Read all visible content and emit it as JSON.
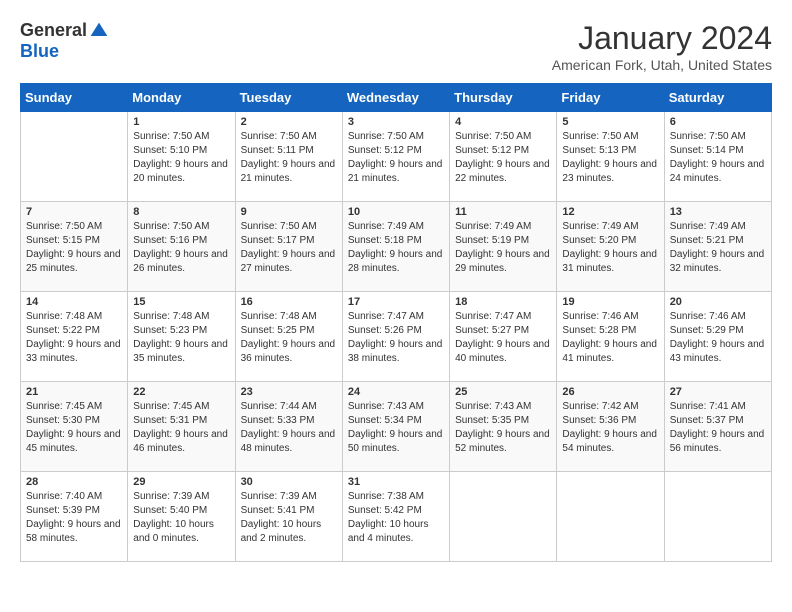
{
  "header": {
    "logo_general": "General",
    "logo_blue": "Blue",
    "title": "January 2024",
    "location": "American Fork, Utah, United States"
  },
  "days_of_week": [
    "Sunday",
    "Monday",
    "Tuesday",
    "Wednesday",
    "Thursday",
    "Friday",
    "Saturday"
  ],
  "weeks": [
    [
      {
        "day": "",
        "sunrise": "",
        "sunset": "",
        "daylight": ""
      },
      {
        "day": "1",
        "sunrise": "Sunrise: 7:50 AM",
        "sunset": "Sunset: 5:10 PM",
        "daylight": "Daylight: 9 hours and 20 minutes."
      },
      {
        "day": "2",
        "sunrise": "Sunrise: 7:50 AM",
        "sunset": "Sunset: 5:11 PM",
        "daylight": "Daylight: 9 hours and 21 minutes."
      },
      {
        "day": "3",
        "sunrise": "Sunrise: 7:50 AM",
        "sunset": "Sunset: 5:12 PM",
        "daylight": "Daylight: 9 hours and 21 minutes."
      },
      {
        "day": "4",
        "sunrise": "Sunrise: 7:50 AM",
        "sunset": "Sunset: 5:12 PM",
        "daylight": "Daylight: 9 hours and 22 minutes."
      },
      {
        "day": "5",
        "sunrise": "Sunrise: 7:50 AM",
        "sunset": "Sunset: 5:13 PM",
        "daylight": "Daylight: 9 hours and 23 minutes."
      },
      {
        "day": "6",
        "sunrise": "Sunrise: 7:50 AM",
        "sunset": "Sunset: 5:14 PM",
        "daylight": "Daylight: 9 hours and 24 minutes."
      }
    ],
    [
      {
        "day": "7",
        "sunrise": "Sunrise: 7:50 AM",
        "sunset": "Sunset: 5:15 PM",
        "daylight": "Daylight: 9 hours and 25 minutes."
      },
      {
        "day": "8",
        "sunrise": "Sunrise: 7:50 AM",
        "sunset": "Sunset: 5:16 PM",
        "daylight": "Daylight: 9 hours and 26 minutes."
      },
      {
        "day": "9",
        "sunrise": "Sunrise: 7:50 AM",
        "sunset": "Sunset: 5:17 PM",
        "daylight": "Daylight: 9 hours and 27 minutes."
      },
      {
        "day": "10",
        "sunrise": "Sunrise: 7:49 AM",
        "sunset": "Sunset: 5:18 PM",
        "daylight": "Daylight: 9 hours and 28 minutes."
      },
      {
        "day": "11",
        "sunrise": "Sunrise: 7:49 AM",
        "sunset": "Sunset: 5:19 PM",
        "daylight": "Daylight: 9 hours and 29 minutes."
      },
      {
        "day": "12",
        "sunrise": "Sunrise: 7:49 AM",
        "sunset": "Sunset: 5:20 PM",
        "daylight": "Daylight: 9 hours and 31 minutes."
      },
      {
        "day": "13",
        "sunrise": "Sunrise: 7:49 AM",
        "sunset": "Sunset: 5:21 PM",
        "daylight": "Daylight: 9 hours and 32 minutes."
      }
    ],
    [
      {
        "day": "14",
        "sunrise": "Sunrise: 7:48 AM",
        "sunset": "Sunset: 5:22 PM",
        "daylight": "Daylight: 9 hours and 33 minutes."
      },
      {
        "day": "15",
        "sunrise": "Sunrise: 7:48 AM",
        "sunset": "Sunset: 5:23 PM",
        "daylight": "Daylight: 9 hours and 35 minutes."
      },
      {
        "day": "16",
        "sunrise": "Sunrise: 7:48 AM",
        "sunset": "Sunset: 5:25 PM",
        "daylight": "Daylight: 9 hours and 36 minutes."
      },
      {
        "day": "17",
        "sunrise": "Sunrise: 7:47 AM",
        "sunset": "Sunset: 5:26 PM",
        "daylight": "Daylight: 9 hours and 38 minutes."
      },
      {
        "day": "18",
        "sunrise": "Sunrise: 7:47 AM",
        "sunset": "Sunset: 5:27 PM",
        "daylight": "Daylight: 9 hours and 40 minutes."
      },
      {
        "day": "19",
        "sunrise": "Sunrise: 7:46 AM",
        "sunset": "Sunset: 5:28 PM",
        "daylight": "Daylight: 9 hours and 41 minutes."
      },
      {
        "day": "20",
        "sunrise": "Sunrise: 7:46 AM",
        "sunset": "Sunset: 5:29 PM",
        "daylight": "Daylight: 9 hours and 43 minutes."
      }
    ],
    [
      {
        "day": "21",
        "sunrise": "Sunrise: 7:45 AM",
        "sunset": "Sunset: 5:30 PM",
        "daylight": "Daylight: 9 hours and 45 minutes."
      },
      {
        "day": "22",
        "sunrise": "Sunrise: 7:45 AM",
        "sunset": "Sunset: 5:31 PM",
        "daylight": "Daylight: 9 hours and 46 minutes."
      },
      {
        "day": "23",
        "sunrise": "Sunrise: 7:44 AM",
        "sunset": "Sunset: 5:33 PM",
        "daylight": "Daylight: 9 hours and 48 minutes."
      },
      {
        "day": "24",
        "sunrise": "Sunrise: 7:43 AM",
        "sunset": "Sunset: 5:34 PM",
        "daylight": "Daylight: 9 hours and 50 minutes."
      },
      {
        "day": "25",
        "sunrise": "Sunrise: 7:43 AM",
        "sunset": "Sunset: 5:35 PM",
        "daylight": "Daylight: 9 hours and 52 minutes."
      },
      {
        "day": "26",
        "sunrise": "Sunrise: 7:42 AM",
        "sunset": "Sunset: 5:36 PM",
        "daylight": "Daylight: 9 hours and 54 minutes."
      },
      {
        "day": "27",
        "sunrise": "Sunrise: 7:41 AM",
        "sunset": "Sunset: 5:37 PM",
        "daylight": "Daylight: 9 hours and 56 minutes."
      }
    ],
    [
      {
        "day": "28",
        "sunrise": "Sunrise: 7:40 AM",
        "sunset": "Sunset: 5:39 PM",
        "daylight": "Daylight: 9 hours and 58 minutes."
      },
      {
        "day": "29",
        "sunrise": "Sunrise: 7:39 AM",
        "sunset": "Sunset: 5:40 PM",
        "daylight": "Daylight: 10 hours and 0 minutes."
      },
      {
        "day": "30",
        "sunrise": "Sunrise: 7:39 AM",
        "sunset": "Sunset: 5:41 PM",
        "daylight": "Daylight: 10 hours and 2 minutes."
      },
      {
        "day": "31",
        "sunrise": "Sunrise: 7:38 AM",
        "sunset": "Sunset: 5:42 PM",
        "daylight": "Daylight: 10 hours and 4 minutes."
      },
      {
        "day": "",
        "sunrise": "",
        "sunset": "",
        "daylight": ""
      },
      {
        "day": "",
        "sunrise": "",
        "sunset": "",
        "daylight": ""
      },
      {
        "day": "",
        "sunrise": "",
        "sunset": "",
        "daylight": ""
      }
    ]
  ]
}
